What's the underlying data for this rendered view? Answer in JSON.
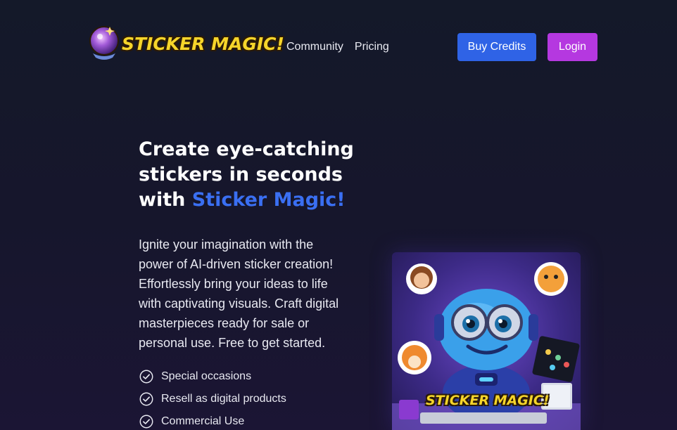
{
  "header": {
    "logo_text": "STICKER MAGIC!",
    "nav": {
      "community": "Community",
      "pricing": "Pricing"
    },
    "buy_credits": "Buy Credits",
    "login": "Login"
  },
  "hero": {
    "headline_prefix": "Create eye-catching stickers in seconds with ",
    "headline_accent": "Sticker Magic!",
    "lead": "Ignite your imagination with the power of AI-driven sticker creation! Effortlessly bring your ideas to life with captivating visuals. Craft digital masterpieces ready for sale or personal use. Free to get started.",
    "features": [
      "Special occasions",
      "Resell as digital products",
      "Commercial Use"
    ],
    "image_caption": "STICKER MAGIC!"
  },
  "colors": {
    "background": "#141929",
    "accent_blue": "#2f63e6",
    "accent_purple": "#b538e0",
    "logo_yellow": "#f6d52a"
  },
  "icons": [
    "magic-orb-icon",
    "check-circle-icon"
  ]
}
